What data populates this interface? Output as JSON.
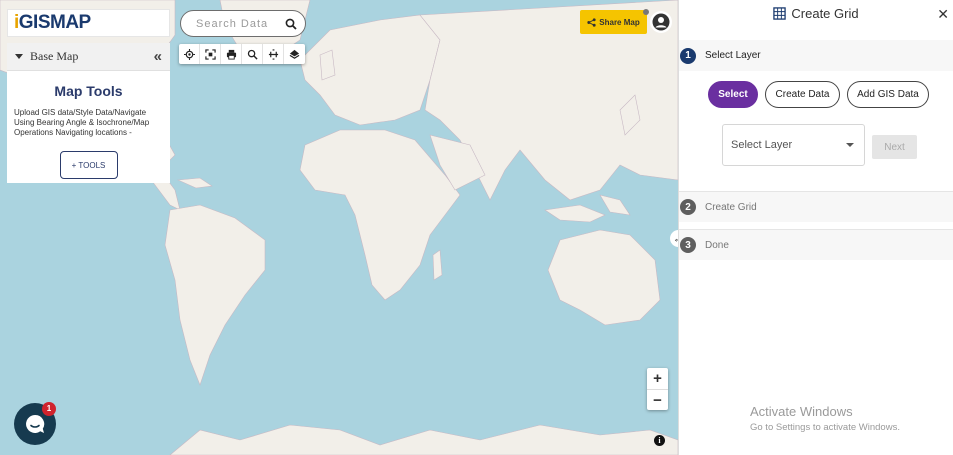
{
  "logo": {
    "i": "i",
    "rest": "GISMAP"
  },
  "search": {
    "placeholder": "Search Data"
  },
  "toolbar": {
    "icons": [
      "locate-icon",
      "fullscreen-icon",
      "print-icon",
      "zoom-search-icon",
      "measure-icon",
      "layers-icon"
    ]
  },
  "basemap": {
    "label": "Base Map",
    "collapse": "«"
  },
  "tools": {
    "title": "Map Tools",
    "description": "Upload GIS data/Style Data/Navigate Using Bearing Angle & Isochrone/Map Operations Navigating locations -",
    "button": "+ TOOLS"
  },
  "share": {
    "label": "Share Map"
  },
  "zoom": {
    "in": "+",
    "out": "−"
  },
  "info": "i",
  "chat": {
    "badge": "1"
  },
  "panel": {
    "title": "Create Grid",
    "close": "✕",
    "steps": [
      {
        "number": "1",
        "label": "Select Layer"
      },
      {
        "number": "2",
        "label": "Create Grid"
      },
      {
        "number": "3",
        "label": "Done"
      }
    ],
    "buttons": {
      "select": "Select",
      "create_data": "Create Data",
      "add_gis": "Add GIS Data"
    },
    "select_layer": "Select Layer",
    "next": "Next"
  },
  "watermark": {
    "line1": "Activate Windows",
    "line2": "Go to Settings to activate Windows."
  },
  "colors": {
    "water": "#aad3df",
    "land": "#f2efe9",
    "accent_purple": "#6a2fa0",
    "share_yellow": "#f5c400",
    "brand_navy": "#1a3a6e"
  }
}
